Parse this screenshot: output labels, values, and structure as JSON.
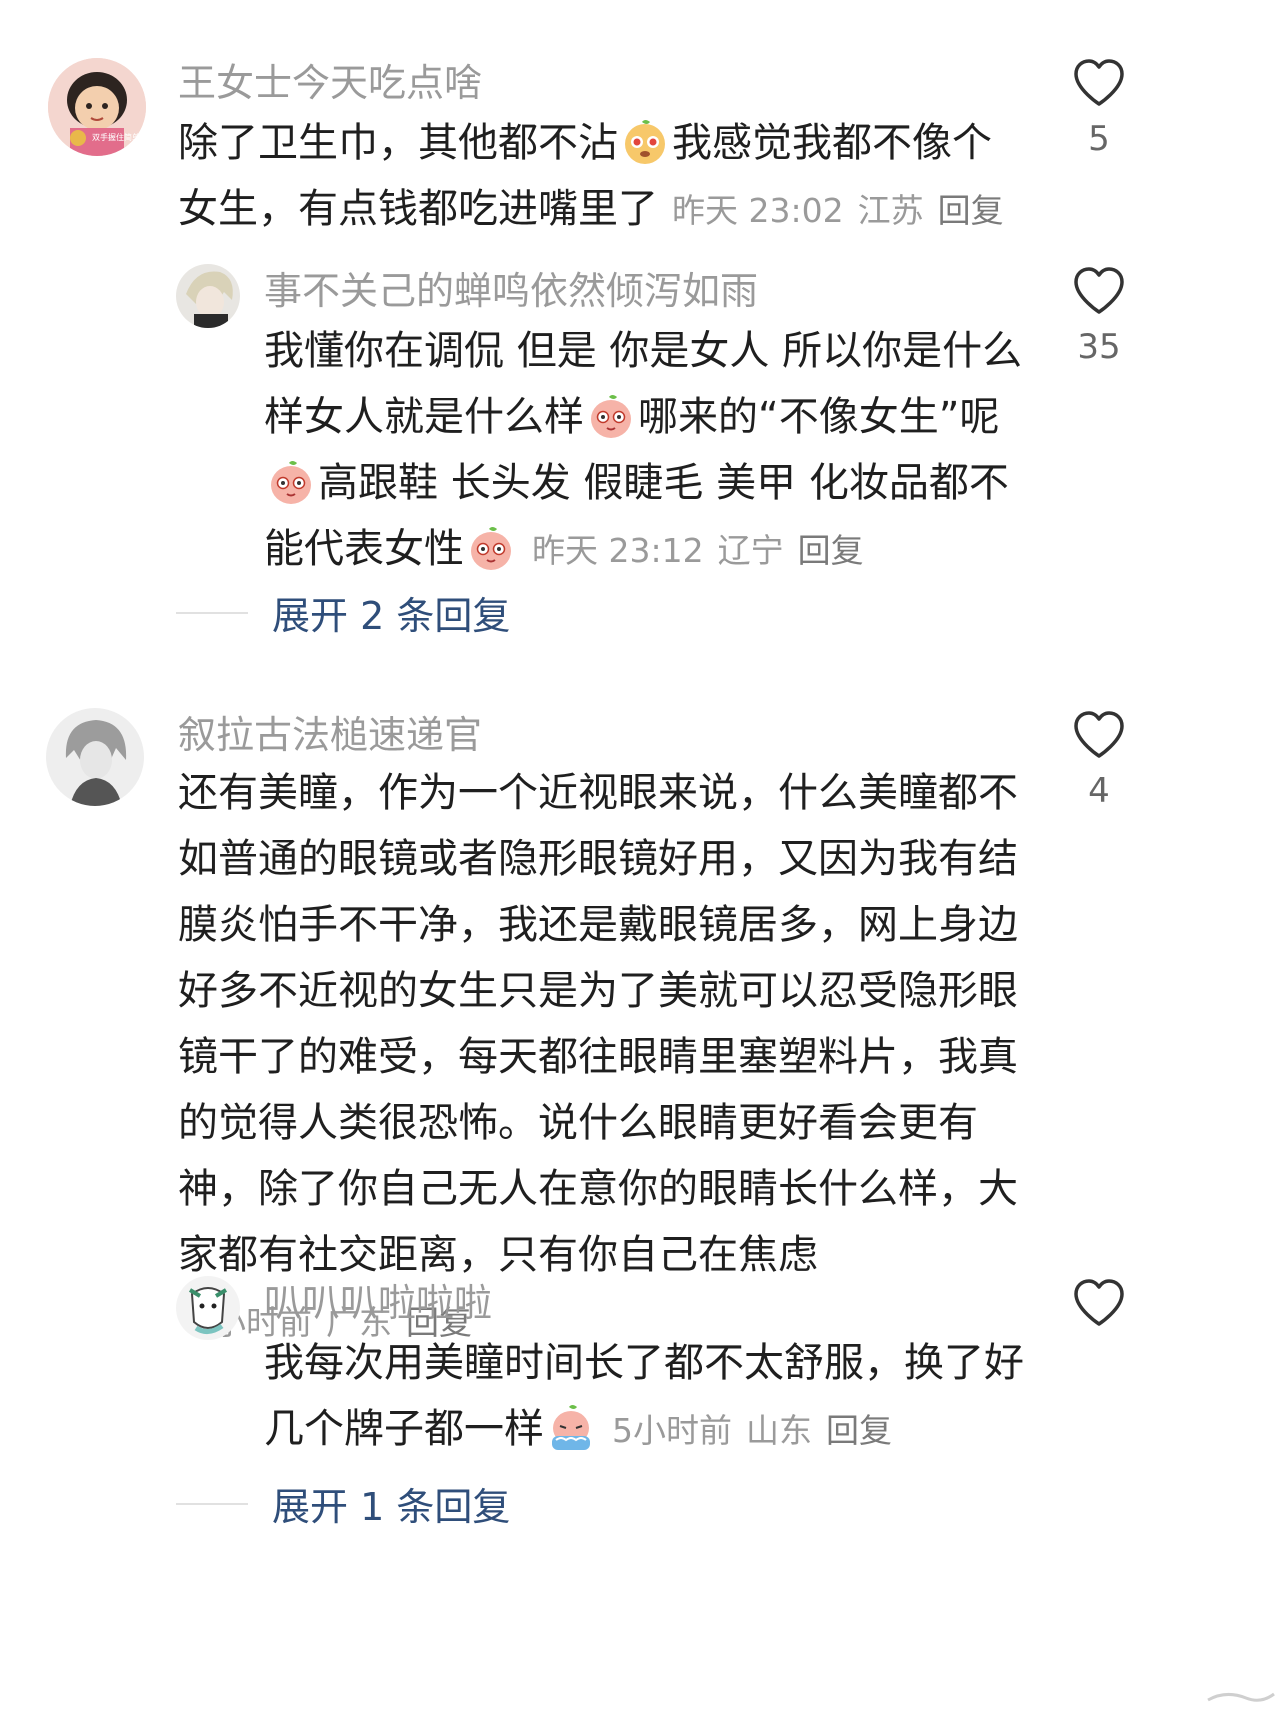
{
  "comments": [
    {
      "username": "王女士今天吃点啥",
      "avatar_icon": "cartoon-girl-avatar",
      "avatar_text": "双手握住简单的快乐",
      "text_before_emoji": "除了卫生巾，其他都不沾",
      "emoji_name": "drooling-peach-emoji",
      "text_after_emoji": "我感觉我都不像个女生，有点钱都吃进嘴里了",
      "time": "昨天 23:02",
      "location": "江苏",
      "reply_label": "回复",
      "likes": "5"
    },
    {
      "username": "事不关己的蝉鸣依然倾泻如雨",
      "avatar_icon": "anime-character-avatar",
      "text_parts": [
        "我懂你在调侃 但是 你是女人 所以你是什么样女人就是什么样",
        "哪来的“不像女生”呢",
        "高跟鞋 长头发 假睫毛 美甲 化妆品都不能代表女性",
        ""
      ],
      "emoji_name": "shy-peach-emoji",
      "time": "昨天 23:12",
      "location": "辽宁",
      "reply_label": "回复",
      "likes": "35",
      "expand_label": "展开 2 条回复"
    },
    {
      "username": "叙拉古法槌速递官",
      "avatar_icon": "anime-sketch-avatar",
      "text": "还有美瞳，作为一个近视眼来说，什么美瞳都不如普通的眼镜或者隐形眼镜好用，又因为我有结膜炎怕手不干净，我还是戴眼镜居多，网上身边好多不近视的女生只是为了美就可以忍受隐形眼镜干了的难受，每天都往眼睛里塞塑料片，我真的觉得人类很恐怖。说什么眼睛更好看会更有神，除了你自己无人在意你的眼睛长什么样，大家都有社交距离，只有你自己在焦虑",
      "time": "5小时前",
      "location": "广东",
      "reply_label": "回复",
      "likes": "4"
    },
    {
      "username": "叭叭叭啦啦啦",
      "avatar_icon": "cartoon-creature-avatar",
      "text_before_emoji": "我每次用美瞳时间长了都不太舒服，换了好几个牌子都一样",
      "emoji_name": "crying-peach-emoji",
      "time": "5小时前",
      "location": "山东",
      "reply_label": "回复",
      "likes": "",
      "expand_label": "展开 1 条回复"
    }
  ],
  "colors": {
    "username": "#9a9a9a",
    "body": "#1f1f1f",
    "meta": "#9a9a9a",
    "expand": "#2f4e7a"
  }
}
